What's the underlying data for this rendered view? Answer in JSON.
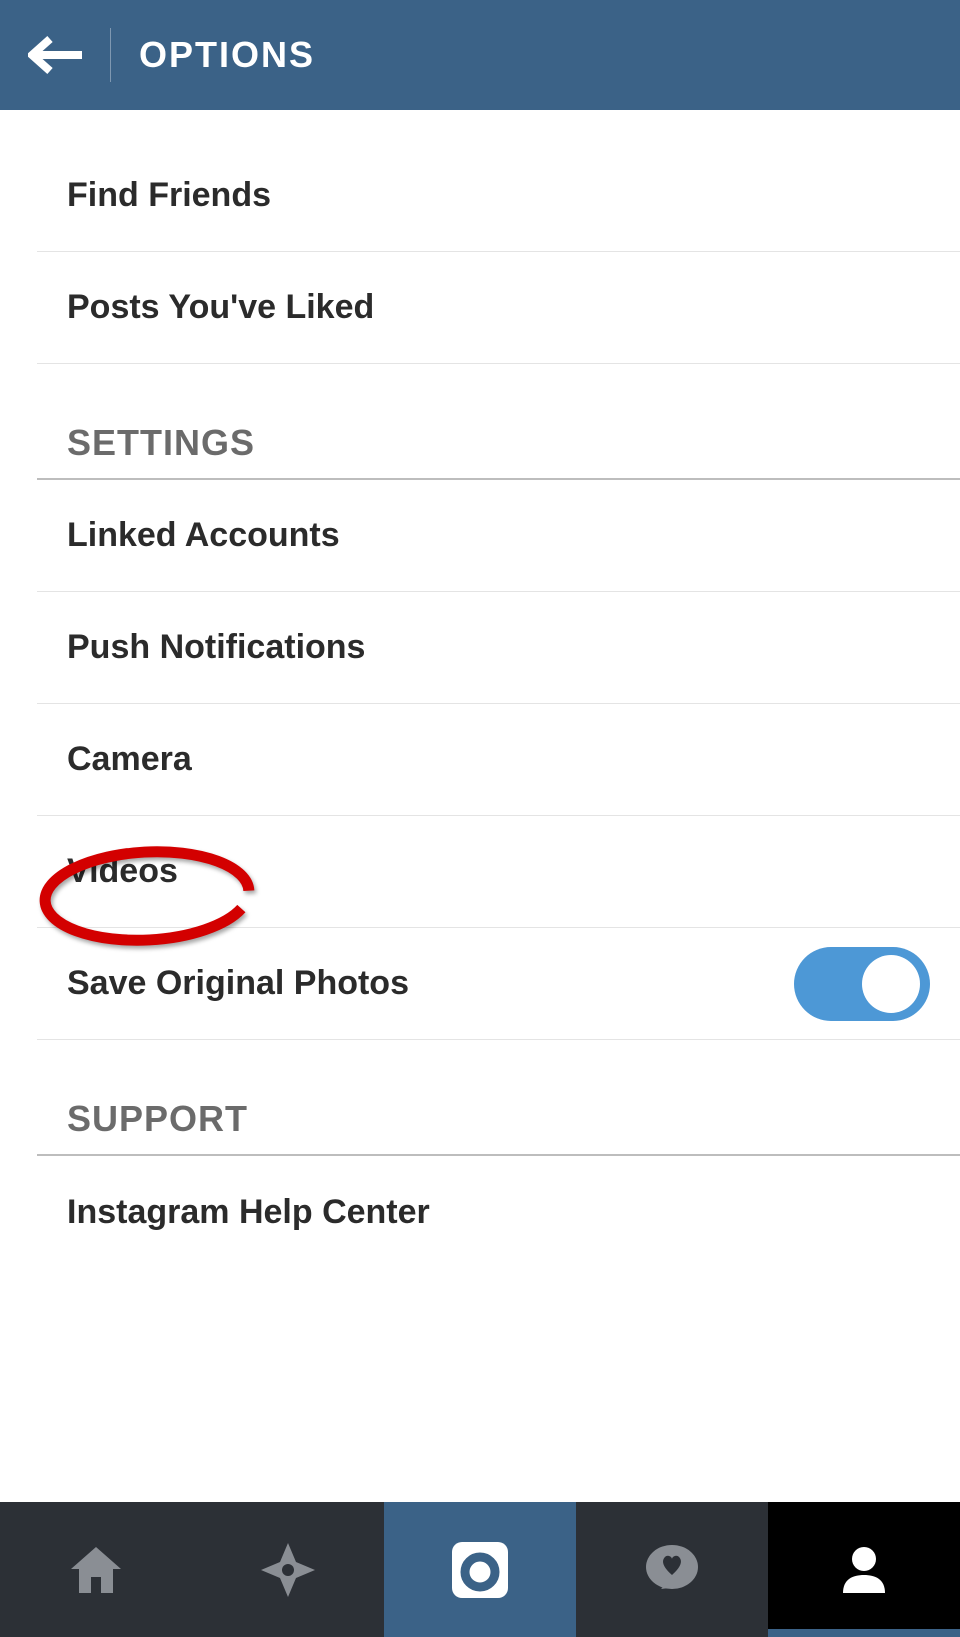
{
  "header": {
    "title": "OPTIONS"
  },
  "top_items": [
    {
      "label": "Find Friends"
    },
    {
      "label": "Posts You've Liked"
    }
  ],
  "sections": [
    {
      "title": "SETTINGS",
      "items": [
        {
          "label": "Linked Accounts",
          "type": "nav"
        },
        {
          "label": "Push Notifications",
          "type": "nav"
        },
        {
          "label": "Camera",
          "type": "nav"
        },
        {
          "label": "Videos",
          "type": "nav",
          "highlighted": true
        },
        {
          "label": "Save Original Photos",
          "type": "toggle",
          "value": true
        }
      ]
    },
    {
      "title": "SUPPORT",
      "items": [
        {
          "label": "Instagram Help Center",
          "type": "nav"
        }
      ]
    }
  ],
  "navbar": {
    "items": [
      {
        "icon": "home"
      },
      {
        "icon": "explore"
      },
      {
        "icon": "camera",
        "active": "camera"
      },
      {
        "icon": "activity"
      },
      {
        "icon": "profile",
        "active": "profile"
      }
    ]
  },
  "colors": {
    "header_bg": "#3b6287",
    "toggle_on": "#4d98d6",
    "navbar_bg": "#2c3036",
    "annotation": "#d30000"
  }
}
